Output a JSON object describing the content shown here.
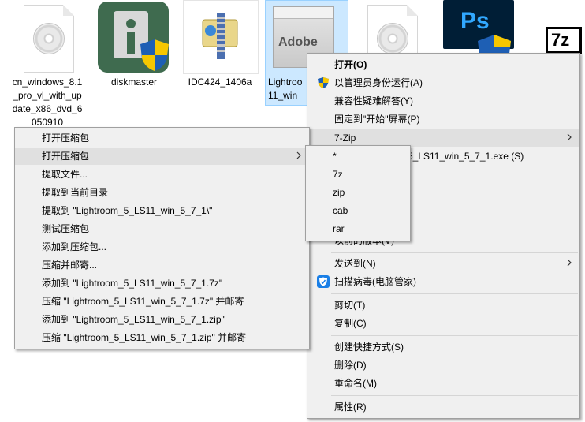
{
  "files": [
    {
      "label": "cn_windows_8.1\n_pro_vl_with_up\ndate_x86_dvd_6\n050910",
      "icon": "disc-document-icon"
    },
    {
      "label": "diskmaster",
      "icon": "diskmaster-app-icon"
    },
    {
      "label": "IDC424_1406a",
      "icon": "winzip-archive-icon"
    },
    {
      "label": "Lightroo\n11_win",
      "icon": "adobe-installer-box-icon"
    },
    {
      "label": "",
      "icon": "disc-document-icon"
    },
    {
      "label": "",
      "icon": "photoshop-icon",
      "icon_text": "Ps"
    },
    {
      "label": "",
      "icon": "7zip-icon",
      "icon_text": "7z"
    }
  ],
  "main_menu": {
    "items": [
      {
        "label": "打开(O)",
        "bold": true
      },
      {
        "label": "以管理员身份运行(A)",
        "icon": "uac-shield-icon"
      },
      {
        "label": "兼容性疑难解答(Y)"
      },
      {
        "label": "固定到\"开始\"屏幕(P)"
      },
      {
        "label": "7-Zip",
        "submenu": true,
        "hover": true
      },
      {
        "label": "5_LS11_win_5_7_1.exe (S)"
      },
      {
        "label": "以前的版本(V)"
      },
      {
        "label": "发送到(N)",
        "submenu": true
      },
      {
        "label": "扫描病毒(电脑管家)",
        "icon": "tencent-pc-manager-icon"
      },
      {
        "label": "剪切(T)"
      },
      {
        "label": "复制(C)"
      },
      {
        "label": "创建快捷方式(S)"
      },
      {
        "label": "删除(D)"
      },
      {
        "label": "重命名(M)"
      },
      {
        "label": "属性(R)"
      }
    ]
  },
  "zip_menu": {
    "items": [
      {
        "label": "打开压缩包"
      },
      {
        "label": "打开压缩包",
        "submenu": true,
        "hover": true
      },
      {
        "label": "提取文件..."
      },
      {
        "label": "提取到当前目录"
      },
      {
        "label": "提取到 \"Lightroom_5_LS11_win_5_7_1\\\""
      },
      {
        "label": "测试压缩包"
      },
      {
        "label": "添加到压缩包..."
      },
      {
        "label": "压缩并邮寄..."
      },
      {
        "label": "添加到 \"Lightroom_5_LS11_win_5_7_1.7z\""
      },
      {
        "label": "压缩 \"Lightroom_5_LS11_win_5_7_1.7z\" 并邮寄"
      },
      {
        "label": "添加到 \"Lightroom_5_LS11_win_5_7_1.zip\""
      },
      {
        "label": "压缩 \"Lightroom_5_LS11_win_5_7_1.zip\" 并邮寄"
      }
    ]
  },
  "type_menu": {
    "items": [
      {
        "label": "*"
      },
      {
        "label": "7z"
      },
      {
        "label": "zip"
      },
      {
        "label": "cab"
      },
      {
        "label": "rar"
      }
    ]
  },
  "colors": {
    "menu_bg": "#f0f0f0",
    "menu_hover": "#e0e0e0",
    "selection": "#cce8ff",
    "ps_blue": "#001e36",
    "ps_text": "#31a8ff",
    "diskmaster_green": "#3f6b4f"
  }
}
